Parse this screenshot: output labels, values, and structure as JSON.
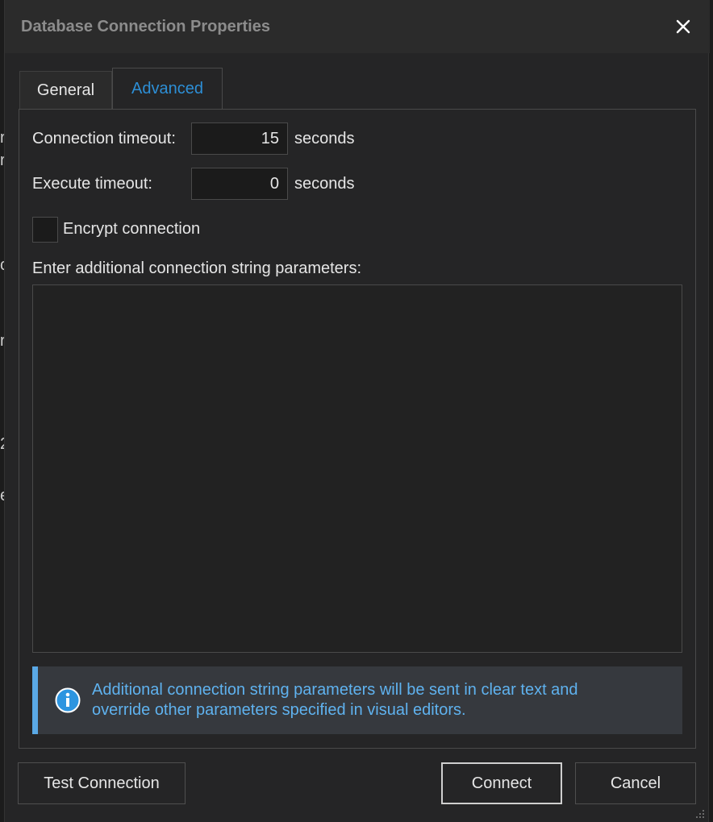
{
  "window": {
    "title": "Database Connection Properties"
  },
  "tabs": [
    {
      "label": "General",
      "active": false
    },
    {
      "label": "Advanced",
      "active": true
    }
  ],
  "form": {
    "connection_timeout_label": "Connection timeout:",
    "connection_timeout_value": "15",
    "connection_timeout_unit": "seconds",
    "execute_timeout_label": "Execute timeout:",
    "execute_timeout_value": "0",
    "execute_timeout_unit": "seconds",
    "encrypt_label": "Encrypt connection",
    "encrypt_checked": false,
    "params_label": "Enter additional connection string parameters:",
    "params_value": ""
  },
  "info": {
    "icon": "info-icon",
    "text_line1": "Additional connection string parameters will be sent in clear text and",
    "text_line2": "override other parameters specified in visual editors."
  },
  "buttons": {
    "test": "Test Connection",
    "connect": "Connect",
    "cancel": "Cancel"
  },
  "colors": {
    "accent": "#2d8fd6",
    "info_text": "#5fb2ef",
    "info_bar": "#5aa9e6",
    "dialog_bg": "#252526"
  }
}
